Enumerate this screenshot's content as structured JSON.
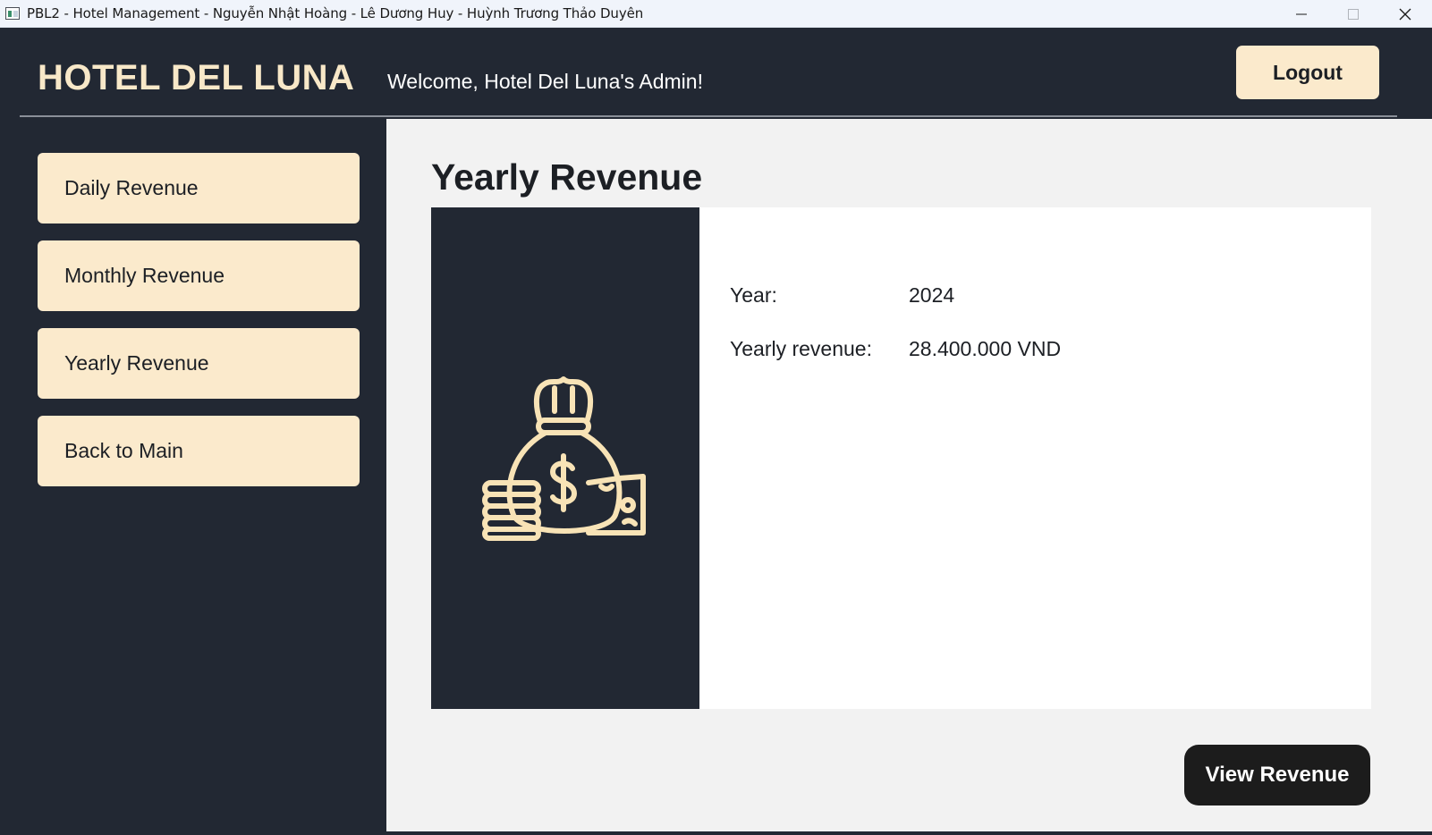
{
  "window": {
    "title": "PBL2 - Hotel Management - Nguyễn Nhật Hoàng - Lê Dương Huy - Huỳnh Trương Thảo Duyên",
    "controls": [
      "minimize-icon",
      "maximize-icon",
      "close-icon"
    ]
  },
  "header": {
    "brand": "HOTEL DEL LUNA",
    "welcome": "Welcome, Hotel Del Luna's Admin!",
    "logout_label": "Logout"
  },
  "sidebar": {
    "items": [
      {
        "label": "Daily Revenue"
      },
      {
        "label": "Monthly Revenue"
      },
      {
        "label": "Yearly Revenue"
      },
      {
        "label": "Back to Main"
      }
    ]
  },
  "main": {
    "title": "Yearly Revenue",
    "card": {
      "icon": "money-bag-icon",
      "year_label": "Year:",
      "year_value": "2024",
      "revenue_label": "Yearly revenue:",
      "revenue_value": "28.400.000 VND"
    },
    "view_button_label": "View Revenue"
  },
  "colors": {
    "dark_bg": "#222833",
    "cream": "#fbeacc",
    "brand_text": "#f8e8c8",
    "content_bg": "#f2f2f2",
    "card_bg": "#ffffff",
    "view_button_bg": "#1c1c1c"
  }
}
